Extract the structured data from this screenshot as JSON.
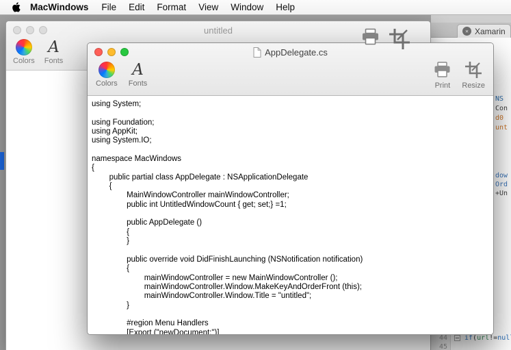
{
  "menu_bar": {
    "items": [
      {
        "label": "MacWindows"
      },
      {
        "label": "File"
      },
      {
        "label": "Edit"
      },
      {
        "label": "Format"
      },
      {
        "label": "View"
      },
      {
        "label": "Window"
      },
      {
        "label": "Help"
      }
    ]
  },
  "background_window": {
    "title": "untitled",
    "toolbar": {
      "colors_label": "Colors",
      "fonts_label": "Fonts"
    }
  },
  "front_window": {
    "title": "AppDelegate.cs",
    "toolbar": {
      "colors_label": "Colors",
      "fonts_label": "Fonts",
      "print_label": "Print",
      "resize_label": "Resize"
    },
    "code_lines": [
      "using System;",
      "",
      "using Foundation;",
      "using AppKit;",
      "using System.IO;",
      "",
      "namespace MacWindows",
      "{",
      "\tpublic partial class AppDelegate : NSApplicationDelegate",
      "\t{",
      "\t\tMainWindowController mainWindowController;",
      "\t\tpublic int UntitledWindowCount { get; set;} =1;",
      "",
      "\t\tpublic AppDelegate ()",
      "\t\t{",
      "\t\t}",
      "",
      "\t\tpublic override void DidFinishLaunching (NSNotification notification)",
      "\t\t{",
      "\t\t\tmainWindowController = new MainWindowController ();",
      "\t\t\tmainWindowController.Window.MakeKeyAndOrderFront (this);",
      "\t\t\tmainWindowController.Window.Title = \"untitled\";",
      "\t\t}",
      "",
      "\t\t#region Menu Handlers",
      "\t\t[Export (\"newDocument:\")]"
    ]
  },
  "xamarin_window": {
    "tab_label": "Xamarin",
    "close_glyph": "✕",
    "code_fragments": [
      {
        "text": "NS",
        "color": "#2f6fae"
      },
      {
        "text": "Con",
        "color": "#444444"
      },
      {
        "text": "d0",
        "color": "#cf7a2e"
      },
      {
        "text": "unt",
        "color": "#cf7a2e"
      },
      {
        "text": "dow",
        "color": "#3a74b8"
      },
      {
        "text": "Ord",
        "color": "#3a74b8"
      },
      {
        "text": "+Un",
        "color": "#444444"
      }
    ],
    "line_numbers": [
      "44",
      "45"
    ],
    "line44_tokens": [
      {
        "text": "if ",
        "color": "#2a6fba"
      },
      {
        "text": "(",
        "color": "#333333"
      },
      {
        "text": "url",
        "color": "#3d8f5f"
      },
      {
        "text": " != ",
        "color": "#333333"
      },
      {
        "text": "null",
        "color": "#2a6fba"
      },
      {
        "text": ") {",
        "color": "#333333"
      }
    ]
  },
  "colors": {
    "traffic_red": "#ff5f57",
    "traffic_yellow": "#febc2e",
    "traffic_green": "#28c840",
    "selection_blue": "#1d6ae5"
  }
}
